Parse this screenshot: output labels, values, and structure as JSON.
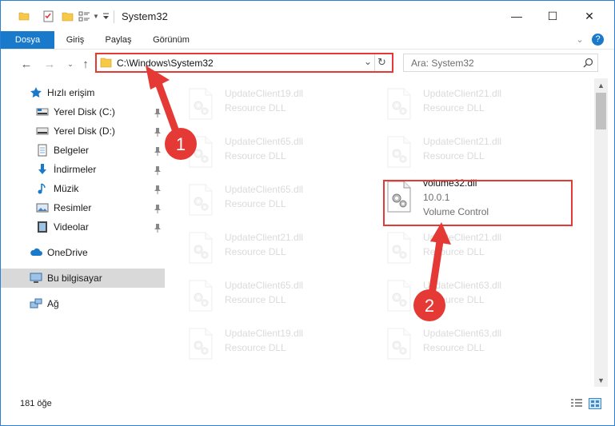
{
  "window": {
    "title": "System32",
    "controls": {
      "minimize": "—",
      "maximize": "☐",
      "close": "✕"
    }
  },
  "ribbon": {
    "tabs": [
      "Dosya",
      "Giriş",
      "Paylaş",
      "Görünüm"
    ],
    "help": "?"
  },
  "address": {
    "path": "C:\\Windows\\System32",
    "search_placeholder": "Ara: System32"
  },
  "navpane": {
    "quick_access": "Hızlı erişim",
    "pinned": [
      {
        "label": "Yerel Disk (C:)",
        "icon": "drive-icon"
      },
      {
        "label": "Yerel Disk (D:)",
        "icon": "drive-icon"
      },
      {
        "label": "Belgeler",
        "icon": "documents-icon"
      },
      {
        "label": "İndirmeler",
        "icon": "downloads-icon"
      },
      {
        "label": "Müzik",
        "icon": "music-icon"
      },
      {
        "label": "Resimler",
        "icon": "pictures-icon"
      },
      {
        "label": "Videolar",
        "icon": "videos-icon"
      }
    ],
    "onedrive": "OneDrive",
    "this_pc": "Bu bilgisayar",
    "network": "Ağ"
  },
  "files": {
    "left_column": [
      {
        "name": "UpdateClient19.dll",
        "type": "Resource DLL"
      },
      {
        "name": "UpdateClient65.dll",
        "type": "Resource DLL"
      },
      {
        "name": "UpdateClient65.dll",
        "type": "Resource DLL"
      },
      {
        "name": "UpdateClient21.dll",
        "type": "Resource DLL"
      },
      {
        "name": "UpdateClient65.dll",
        "type": "Resource DLL"
      },
      {
        "name": "UpdateClient19.dll",
        "type": "Resource DLL"
      }
    ],
    "right_column": [
      {
        "name": "UpdateClient21.dll",
        "type": "Resource DLL"
      },
      {
        "name": "UpdateClient21.dll",
        "type": "Resource DLL"
      },
      {
        "name": "UpdateClient21.dll",
        "type": "Resource DLL"
      },
      {
        "name": "UpdateClient63.dll",
        "type": "Resource DLL"
      },
      {
        "name": "UpdateClient63.dll",
        "type": "Resource DLL"
      }
    ],
    "highlighted": {
      "name": "volume32.dll",
      "version": "10.0.1",
      "description": "Volume Control"
    }
  },
  "annotations": {
    "step1": "1",
    "step2": "2",
    "color": "#e53935"
  },
  "status": {
    "item_count": "181 öğe"
  },
  "colors": {
    "accent": "#1979ca",
    "highlight": "#e53935",
    "selection": "#d9d9d9"
  }
}
